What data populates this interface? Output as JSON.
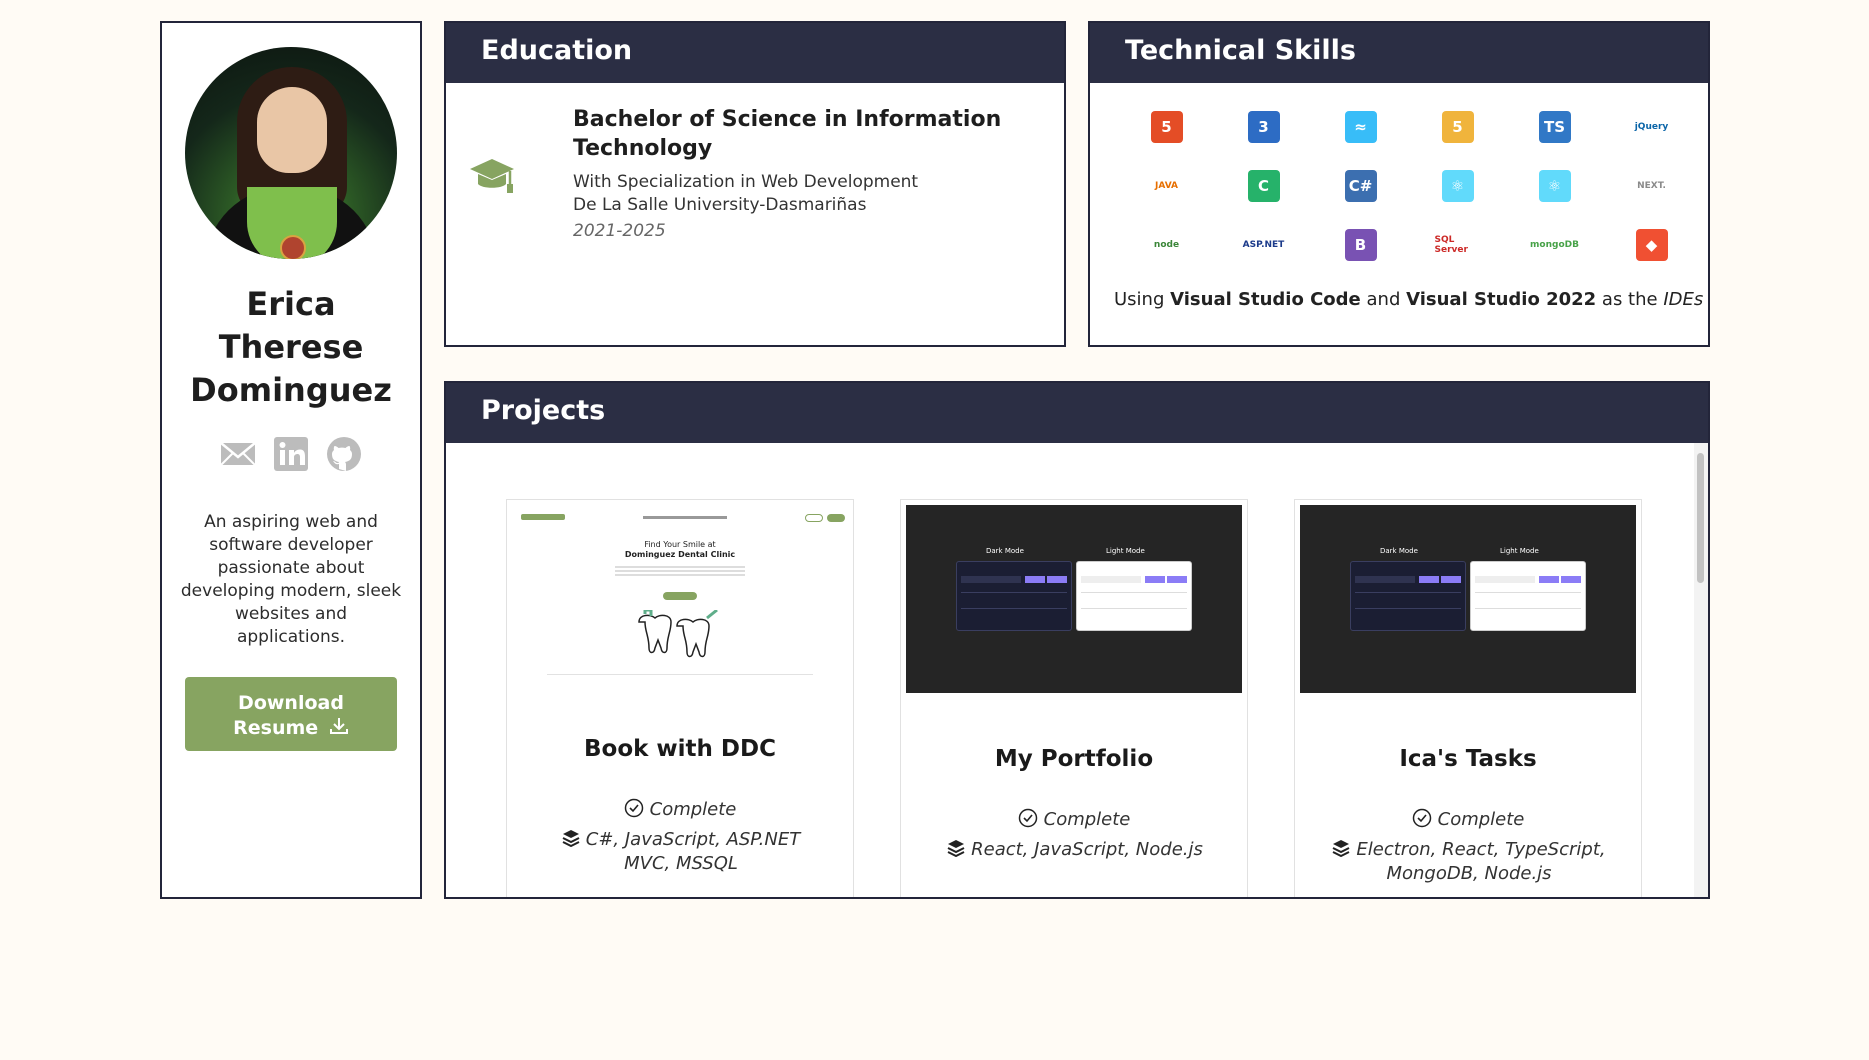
{
  "profile": {
    "name_line1": "Erica",
    "name_line2": "Therese",
    "name_line3": "Dominguez",
    "socials": [
      "mail-icon",
      "linkedin-icon",
      "github-icon"
    ],
    "about": "An aspiring web and software developer passionate about developing modern, sleek websites and applications.",
    "download_line1": "Download",
    "download_line2": "Resume"
  },
  "education": {
    "heading": "Education",
    "degree": "Bachelor of Science in Information Technology",
    "specialization": "With Specialization in Web Development",
    "school": "De La Salle University-Dasmariñas",
    "years": "2021-2025"
  },
  "skills": {
    "heading": "Technical Skills",
    "icons": [
      {
        "name": "html5",
        "label": "5",
        "color": "#e44d26"
      },
      {
        "name": "css3",
        "label": "3",
        "color": "#2d6cc4"
      },
      {
        "name": "tailwind",
        "label": "≈",
        "color": "#38bdf8"
      },
      {
        "name": "ui-shield",
        "label": "5",
        "color": "#f0b43c"
      },
      {
        "name": "typescript",
        "label": "TS",
        "color": "#3178c6"
      },
      {
        "name": "jquery",
        "label": "jQuery",
        "color": "#0b65a8"
      },
      {
        "name": "java",
        "label": "JAVA",
        "color": "#e76f00"
      },
      {
        "name": "csharp-green",
        "label": "C",
        "color": "#26b26a"
      },
      {
        "name": "csharp",
        "label": "C#",
        "color": "#3c6fb0"
      },
      {
        "name": "react",
        "label": "⚛",
        "color": "#61dafb"
      },
      {
        "name": "react-native",
        "label": "⚛",
        "color": "#61dafb"
      },
      {
        "name": "nextjs",
        "label": "NEXT.",
        "color": "#8a8a8a"
      },
      {
        "name": "nodejs",
        "label": "node",
        "color": "#3c873a"
      },
      {
        "name": "aspnet",
        "label": "ASP.NET",
        "color": "#1b3a8a"
      },
      {
        "name": "bootstrap",
        "label": "B",
        "color": "#7952b3"
      },
      {
        "name": "sqlserver",
        "label": "SQL Server",
        "color": "#cc2927"
      },
      {
        "name": "mongodb",
        "label": "mongoDB",
        "color": "#47a248"
      },
      {
        "name": "git",
        "label": "◆",
        "color": "#f05032"
      }
    ],
    "ide_prefix": "Using",
    "ide1": "Visual Studio Code",
    "ide_and": "and",
    "ide2": "Visual Studio 2022",
    "ide_as": "as the",
    "ide_term": "IDEs"
  },
  "projects": {
    "heading": "Projects",
    "items": [
      {
        "title": "Book with DDC",
        "status": "Complete",
        "tech": "C#, JavaScript, ASP.NET MVC, MSSQL",
        "thumb_headline1": "Find Your Smile at",
        "thumb_headline2": "Dominguez Dental Clinic"
      },
      {
        "title": "My Portfolio",
        "status": "Complete",
        "tech": "React, JavaScript, Node.js",
        "thumb_dark": "Dark Mode",
        "thumb_light": "Light Mode"
      },
      {
        "title": "Ica's Tasks",
        "status": "Complete",
        "tech": "Electron, React, TypeScript, MongoDB, Node.js",
        "thumb_dark": "Dark Mode",
        "thumb_light": "Light Mode"
      }
    ]
  },
  "colors": {
    "header_bg": "#2b2e44",
    "accent_green": "#87a461",
    "page_bg": "#fffbf5"
  }
}
